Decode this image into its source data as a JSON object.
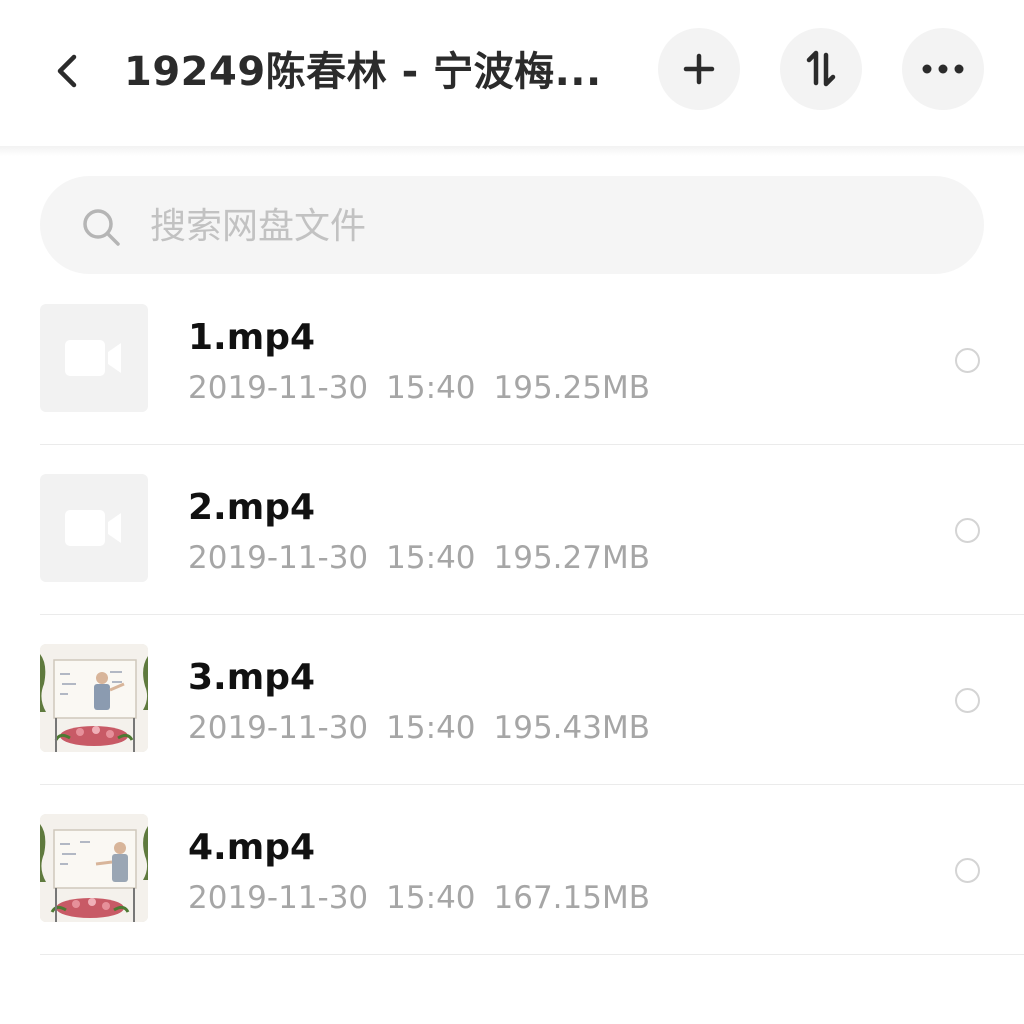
{
  "header": {
    "title": "19249陈春林 - 宁波梅...",
    "back_icon": "chevron-left-icon",
    "add_icon": "plus-icon",
    "sort_icon": "sort-arrows-icon",
    "more_icon": "more-dots-icon"
  },
  "search": {
    "placeholder": "搜索网盘文件",
    "icon": "search-icon"
  },
  "files": [
    {
      "name": "1.mp4",
      "date": "2019-11-30",
      "time": "15:40",
      "size": "195.25MB",
      "thumbnail": "video-placeholder-icon"
    },
    {
      "name": "2.mp4",
      "date": "2019-11-30",
      "time": "15:40",
      "size": "195.27MB",
      "thumbnail": "video-placeholder-icon"
    },
    {
      "name": "3.mp4",
      "date": "2019-11-30",
      "time": "15:40",
      "size": "195.43MB",
      "thumbnail": "video-frame-thumbnail"
    },
    {
      "name": "4.mp4",
      "date": "2019-11-30",
      "time": "15:40",
      "size": "167.15MB",
      "thumbnail": "video-frame-thumbnail"
    }
  ],
  "colors": {
    "background": "#ffffff",
    "button_bg": "#f3f3f3",
    "search_bg": "#f5f5f5",
    "meta_text": "#a6a6a6",
    "divider": "#ebebeb"
  }
}
